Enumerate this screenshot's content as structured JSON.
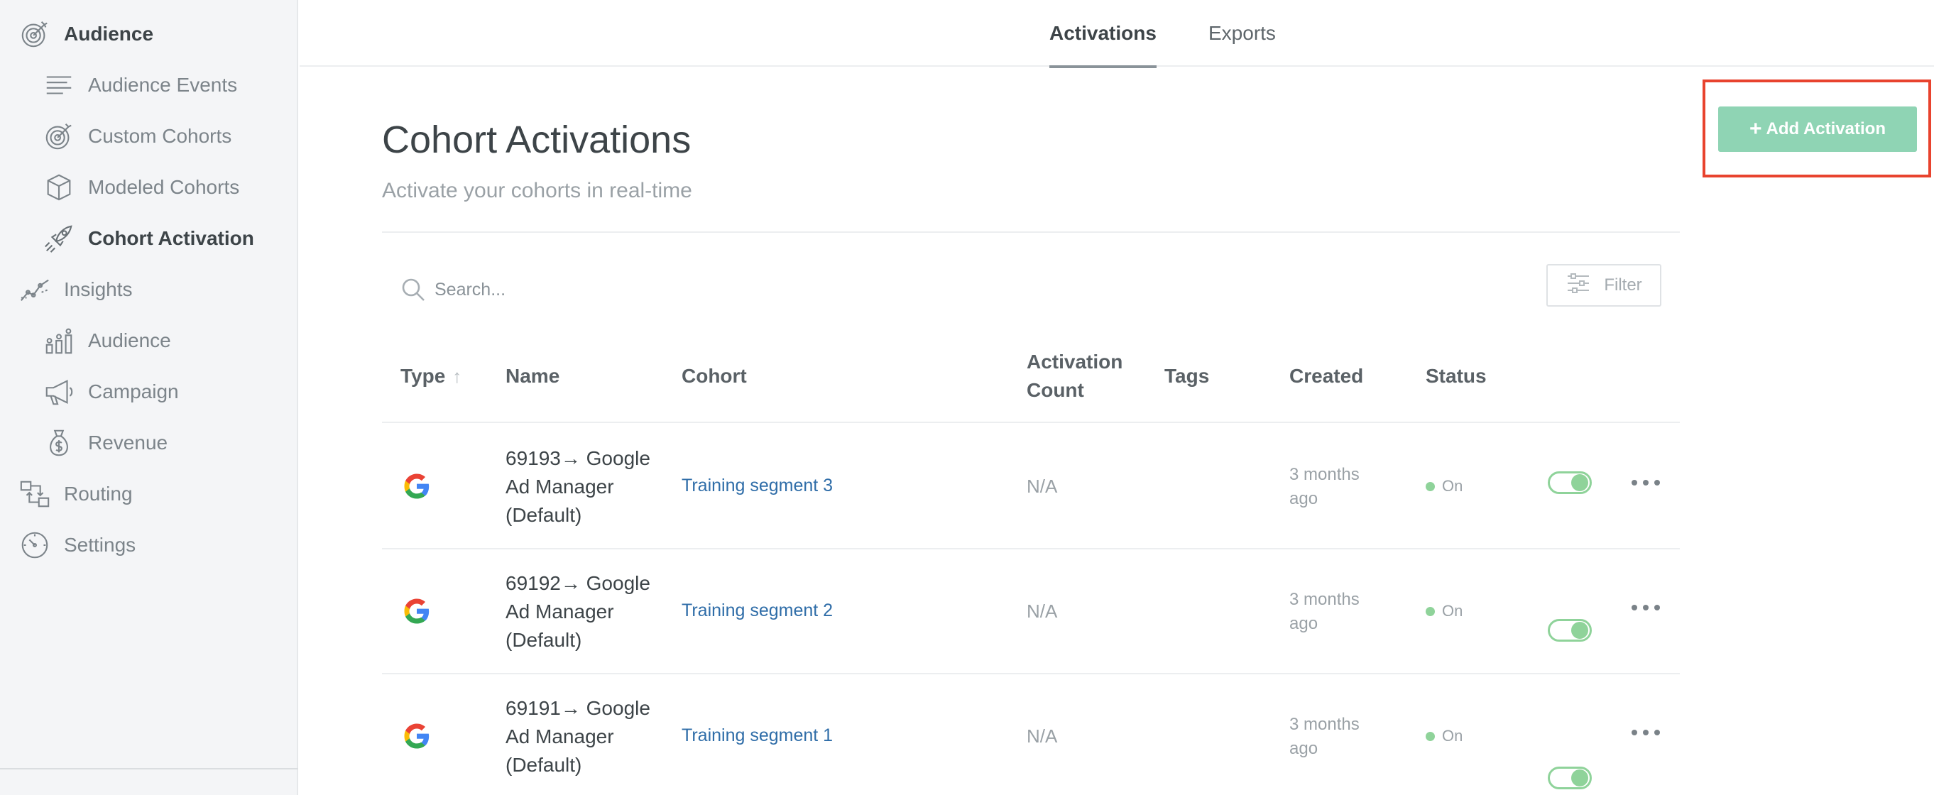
{
  "sidebar": {
    "audience": "Audience",
    "audience_events": "Audience Events",
    "custom_cohorts": "Custom Cohorts",
    "modeled_cohorts": "Modeled Cohorts",
    "cohort_activation": "Cohort Activation",
    "insights": "Insights",
    "insights_audience": "Audience",
    "campaign": "Campaign",
    "revenue": "Revenue",
    "routing": "Routing",
    "settings": "Settings"
  },
  "tabs": {
    "activations": "Activations",
    "exports": "Exports",
    "active": "Activations"
  },
  "header": {
    "title": "Cohort Activations",
    "subtitle": "Activate your cohorts in real-time",
    "add_button": "Add Activation",
    "add_button_plus": "+"
  },
  "search": {
    "placeholder": "Search...",
    "filter_label": "Filter"
  },
  "table": {
    "columns": {
      "type": "Type",
      "name": "Name",
      "cohort": "Cohort",
      "activation_count_line1": "Activation",
      "activation_count_line2": "Count",
      "tags": "Tags",
      "created": "Created",
      "status": "Status"
    },
    "rows": [
      {
        "name_line1": "69193→ Google",
        "name_line2": "Ad Manager",
        "name_line3": "(Default)",
        "cohort": "Training segment 3",
        "activation_count": "N/A",
        "created_line1": "3 months",
        "created_line2": "ago",
        "status": "On",
        "enabled": true
      },
      {
        "name_line1": "69192→ Google",
        "name_line2": "Ad Manager",
        "name_line3": "(Default)",
        "cohort": "Training segment 2",
        "activation_count": "N/A",
        "created_line1": "3 months",
        "created_line2": "ago",
        "status": "On",
        "enabled": true
      },
      {
        "name_line1": "69191→ Google",
        "name_line2": "Ad Manager",
        "name_line3": "(Default)",
        "cohort": "Training segment 1",
        "activation_count": "N/A",
        "created_line1": "3 months",
        "created_line2": "ago",
        "status": "On",
        "enabled": true
      }
    ]
  },
  "colors": {
    "accent_green": "#8fd4b4",
    "highlight_red": "#e8432e",
    "link_blue": "#2f6da8",
    "status_green": "#8fd39a"
  },
  "icons": {
    "audience": "target-icon",
    "audience_events": "list-lines-icon",
    "custom_cohorts": "target-icon",
    "modeled_cohorts": "cube-icon",
    "cohort_activation": "rocket-icon",
    "insights": "line-chart-icon",
    "insights_audience": "people-bars-icon",
    "campaign": "megaphone-icon",
    "revenue": "money-bag-icon",
    "routing": "routing-icon",
    "settings": "gauge-icon",
    "row_type": "google-logo-icon"
  }
}
